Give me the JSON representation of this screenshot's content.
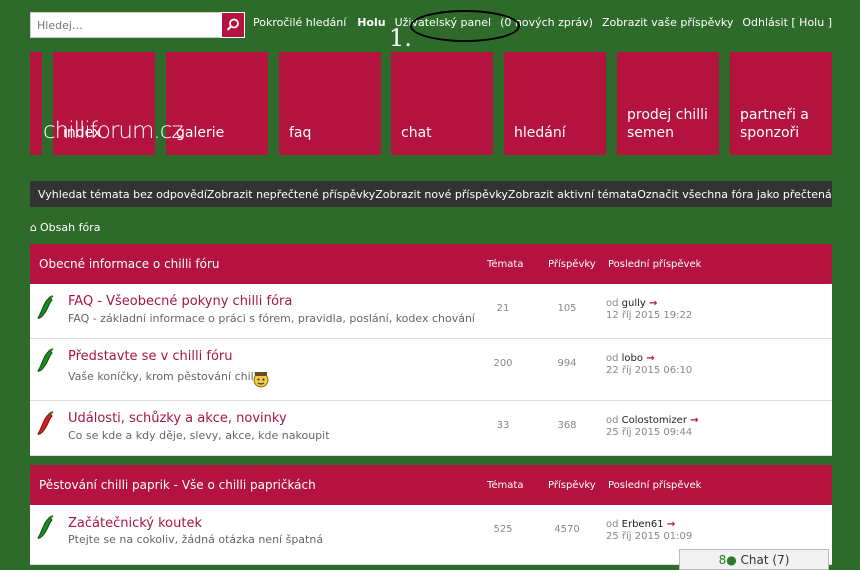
{
  "search": {
    "placeholder": "Hledej…",
    "advanced_label": "Pokročilé hledání"
  },
  "toplinks": {
    "user": "Holu",
    "panel": "Uživatelský panel",
    "messages": "(0 nových zpráv)",
    "posts": "Zobrazit vaše příspěvky",
    "logout": "Odhlásit [ Holu ]"
  },
  "annotation": {
    "number": "1."
  },
  "logo": "chilliforum.cz",
  "tiles": [
    {
      "label": ""
    },
    {
      "label": "index"
    },
    {
      "label": "galerie"
    },
    {
      "label": "faq"
    },
    {
      "label": "chat"
    },
    {
      "label": "hledání"
    },
    {
      "label": "prodej chilli semen"
    },
    {
      "label": "partneři a sponzoři"
    }
  ],
  "navbar": [
    "Vyhledat témata bez odpovědí",
    "Zobrazit nepřečtené příspěvky",
    "Zobrazit nové příspěvky",
    "Zobrazit aktivní témata",
    "Označit všechna fóra jako přečtená"
  ],
  "breadcrumb": "Obsah fóra",
  "columns": {
    "topics": "Témata",
    "posts": "Příspěvky",
    "last": "Poslední příspěvek"
  },
  "forums": [
    {
      "title": "Obecné informace o chilli fóru",
      "rows": [
        {
          "title": "FAQ - Všeobecné pokyny chilli fóra",
          "desc": "FAQ - základní informace o práci s fórem, pravidla, poslání, kodex chování",
          "topics": "21",
          "posts": "105",
          "by_prefix": "od",
          "by": "gully",
          "date": "12 říj 2015 19:22",
          "pepper": "green"
        },
        {
          "title": "Představte se v chilli fóru",
          "desc": "Vaše koníčky, krom pěstování chilli",
          "topics": "200",
          "posts": "994",
          "by_prefix": "od",
          "by": "lobo",
          "date": "22 říj 2015 06:10",
          "pepper": "green"
        },
        {
          "title": "Události, schůzky a akce, novinky",
          "desc": "Co se kde a kdy děje, slevy, akce, kde nakoupit",
          "topics": "33",
          "posts": "368",
          "by_prefix": "od",
          "by": "Colostomizer",
          "date": "25 říj 2015 09:44",
          "pepper": "red"
        }
      ]
    },
    {
      "title": "Pěstování chilli paprik - Vše o chilli papričkách",
      "rows": [
        {
          "title": "Začátečnický koutek",
          "desc": "Ptejte se na cokoliv, žádná otázka není špatná",
          "topics": "525",
          "posts": "4570",
          "by_prefix": "od",
          "by": "Erben61",
          "date": "25 říj 2015 01:09",
          "pepper": "green"
        }
      ]
    }
  ],
  "chat": {
    "label": "Chat (7)"
  },
  "colors": {
    "background": "#2e6b2b",
    "accent": "#b5133f",
    "navbar": "#333333"
  }
}
